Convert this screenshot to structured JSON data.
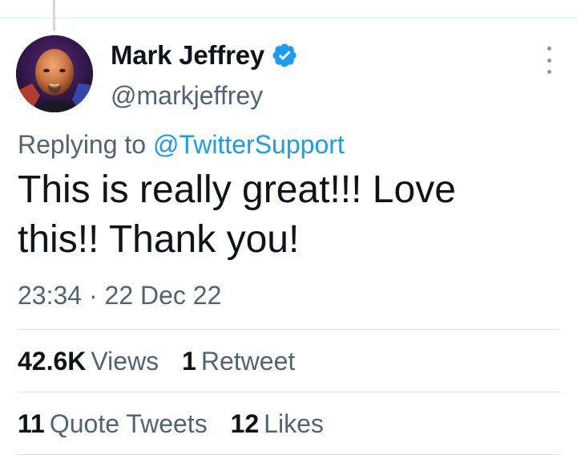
{
  "tweet": {
    "author": {
      "display_name": "Mark Jeffrey",
      "handle": "@markjeffrey",
      "verified": true,
      "avatar_icon": "profile-photo"
    },
    "reply_context": {
      "prefix": "Replying to",
      "mention": "@TwitterSupport"
    },
    "text": "This is really great!!! Love this!! Thank you!",
    "time": "23:34",
    "separator": "·",
    "date": "22 Dec 22",
    "stats_row1": [
      {
        "value": "42.6K",
        "label": "Views"
      },
      {
        "value": "1",
        "label": "Retweet"
      }
    ],
    "stats_row2": [
      {
        "value": "11",
        "label": "Quote Tweets"
      },
      {
        "value": "12",
        "label": "Likes"
      }
    ]
  },
  "colors": {
    "accent": "#1d9bf0",
    "text_primary": "#0f1419",
    "text_secondary": "#536471",
    "divider": "#dbe3e8"
  },
  "icons": {
    "verified": "verified-badge-icon",
    "more": "more-options-icon"
  }
}
